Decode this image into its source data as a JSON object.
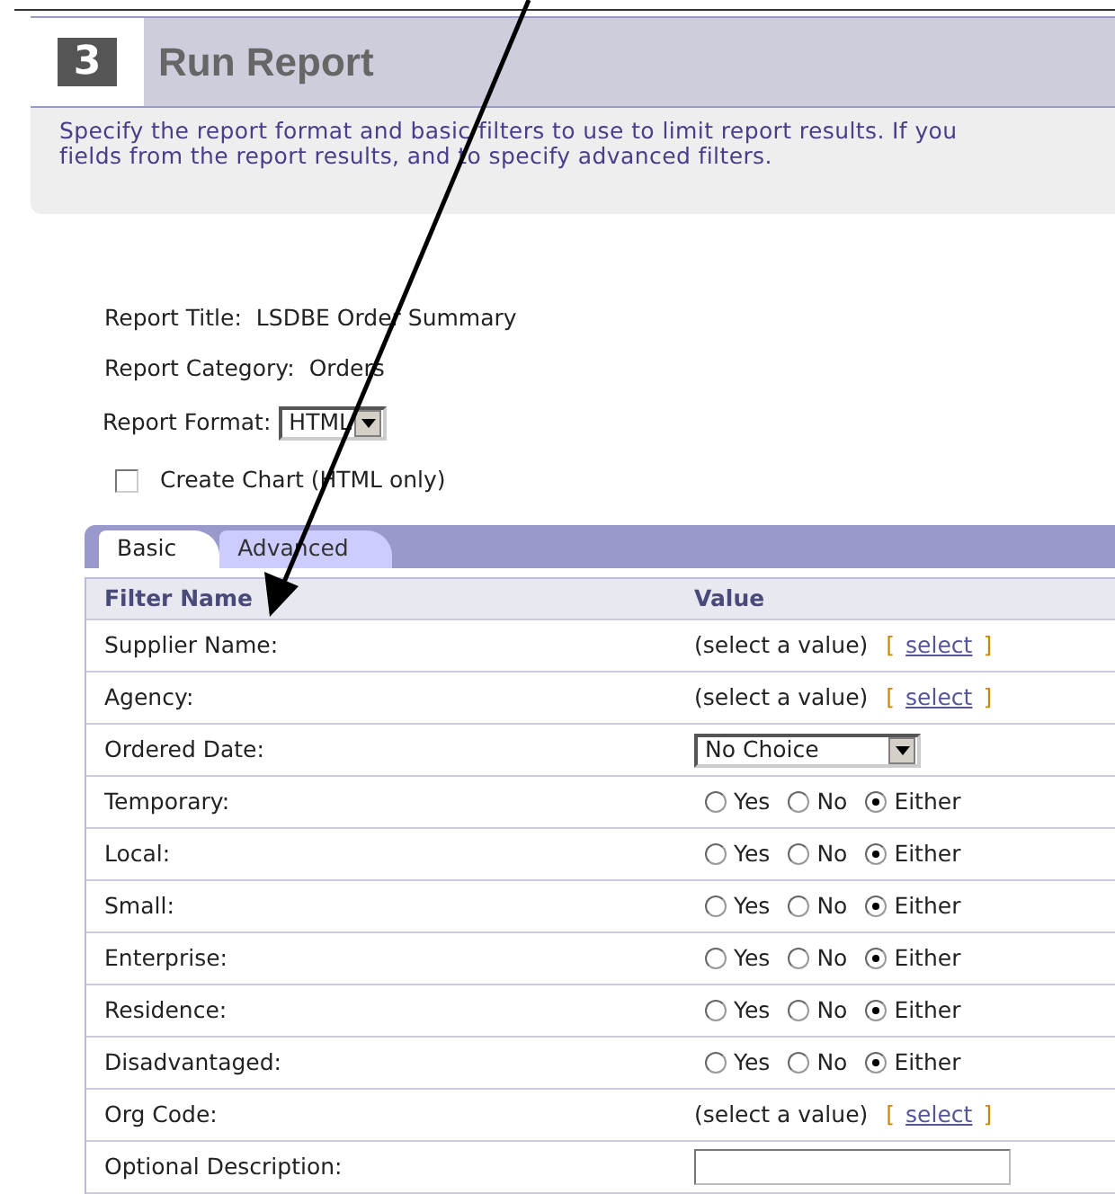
{
  "step": {
    "number": "3",
    "title": "Run Report"
  },
  "description": [
    "Specify the report format and basic filters to use to limit report results. If you",
    "fields from the report results, and to specify advanced filters."
  ],
  "report": {
    "title_label": "Report Title:",
    "title": "LSDBE Order Summary",
    "category_label": "Report Category:",
    "category": "Orders",
    "format_label": "Report Format:",
    "format": "HTML"
  },
  "create_chart": {
    "label": "Create Chart (HTML only)",
    "checked": false
  },
  "tabs": [
    {
      "label": "Basic",
      "selected": true
    },
    {
      "label": "Advanced",
      "selected": false
    }
  ],
  "table": {
    "columns": [
      "Filter Name",
      "Value"
    ],
    "rows": [
      {
        "name": "Supplier Name:",
        "kind": "lookup",
        "value": "(select a value)",
        "open": "[",
        "link": "select",
        "close": "]"
      },
      {
        "name": "Agency:",
        "kind": "lookup",
        "value": "(select a value)",
        "open": "[",
        "link": "select",
        "close": "]"
      },
      {
        "name": "Ordered Date:",
        "kind": "dropdown",
        "value": "No Choice"
      },
      {
        "name": "Temporary:",
        "kind": "radio",
        "options": [
          {
            "label": "Yes",
            "selected": false
          },
          {
            "label": "No",
            "selected": false
          },
          {
            "label": "Either",
            "selected": true
          }
        ]
      },
      {
        "name": "Local:",
        "kind": "radio",
        "options": [
          {
            "label": "Yes",
            "selected": false
          },
          {
            "label": "No",
            "selected": false
          },
          {
            "label": "Either",
            "selected": true
          }
        ]
      },
      {
        "name": "Small:",
        "kind": "radio",
        "options": [
          {
            "label": "Yes",
            "selected": false
          },
          {
            "label": "No",
            "selected": false
          },
          {
            "label": "Either",
            "selected": true
          }
        ]
      },
      {
        "name": "Enterprise:",
        "kind": "radio",
        "options": [
          {
            "label": "Yes",
            "selected": false
          },
          {
            "label": "No",
            "selected": false
          },
          {
            "label": "Either",
            "selected": true
          }
        ]
      },
      {
        "name": "Residence:",
        "kind": "radio",
        "options": [
          {
            "label": "Yes",
            "selected": false
          },
          {
            "label": "No",
            "selected": false
          },
          {
            "label": "Either",
            "selected": true
          }
        ]
      },
      {
        "name": "Disadvantaged:",
        "kind": "radio",
        "options": [
          {
            "label": "Yes",
            "selected": false
          },
          {
            "label": "No",
            "selected": false
          },
          {
            "label": "Either",
            "selected": true
          }
        ]
      },
      {
        "name": "Org Code:",
        "kind": "lookup",
        "value": "(select a value)",
        "open": "[",
        "link": "select",
        "close": "]"
      },
      {
        "name": "Optional Description:",
        "kind": "text"
      }
    ]
  }
}
